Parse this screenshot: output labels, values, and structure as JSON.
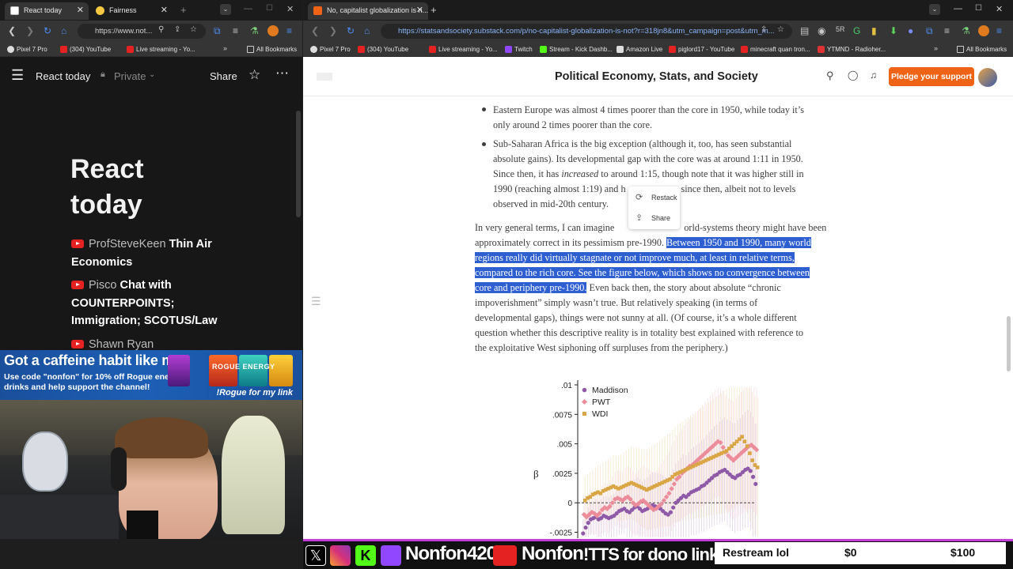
{
  "left_browser": {
    "tabs": [
      {
        "title": "React today",
        "active": true
      },
      {
        "title": "Fairness",
        "active": false
      }
    ],
    "url": "https://www.not...",
    "bookmarks": [
      "Pixel 7 Pro",
      "(304) YouTube",
      "Live streaming - Yo...",
      "All Bookmarks"
    ],
    "page_header": {
      "title": "React today",
      "private_label": "Private",
      "share_label": "Share"
    },
    "page_title": "React today",
    "items": [
      {
        "channel": "ProfSteveKeen",
        "title": "Thin Air Economics"
      },
      {
        "channel": "Pisco",
        "title": "Chat with COUNTERPOINTS; Immigration; SCOTUS/Law"
      },
      {
        "channel": "Shawn Ryan",
        "title": ""
      }
    ]
  },
  "ad_banner": {
    "headline": "Got a caffeine habit like me?",
    "body": "Use code \"nonfon\" for 10% off Rogue energy drinks and help support the channel!",
    "cta": "!Rogue for my link",
    "can_brand": "ROGUE ENERGY"
  },
  "right_browser": {
    "tab_title": "No, capitalist globalization is n...",
    "url": "https://statsandsociety.substack.com/p/no-capitalist-globalization-is-not?r=318jn8&utm_campaign=post&utm_m...",
    "bookmarks": [
      "Pixel 7 Pro",
      "(304) YouTube",
      "Live streaming - Yo...",
      "Twitch",
      "Stream - Kick Dashb...",
      "Amazon Live",
      "piglord17 - YouTube",
      "minecraft quan tron...",
      "YTMND - Radioher...",
      "All Bookmarks"
    ],
    "site_title": "Political Economy, Stats, and Society",
    "pledge_label": "Pledge your support"
  },
  "article": {
    "bullet1": [
      "Eastern Europe was almost 4 times poorer than the core in 1950, while today it’s",
      "only around 2 times poorer than the core."
    ],
    "bullet2": [
      "Sub-Saharan Africa is the big exception (although it, too, has seen substantial",
      "absolute gains). Its developmental gap with the core was at around 1:11 in 1950.",
      "Since then, it has",
      "increased",
      "to around 1:15, though note that it was higher still in",
      "1990 (reaching almost 1:19) and h",
      "since then, albeit not to levels",
      "observed in mid-20th century."
    ],
    "para": {
      "l1a": "In very general terms, I can imagine",
      "l1b": "orld-systems theory might have been",
      "l2a": "approximately correct in its pessimism pre-1990.",
      "l2b": "Between 1950 and 1990, many world",
      "l3": "regions really did virtually stagnate or not improve much, at least in relative terms,",
      "l4": "compared to the rich core. See the figure below, which shows no convergence between",
      "l5a": "core and periphery pre-1990.",
      "l5b": "Even back then, the story about absolute “chronic",
      "l6": "impoverishment” simply wasn’t true. But relatively speaking (in terms of",
      "l7": "developmental gaps), things were not sunny at all. (Of course, it’s a whole different",
      "l8": "question whether this descriptive reality is in totality best explained with reference to",
      "l9": "the exploitative West siphoning off surpluses from the periphery.)"
    }
  },
  "context_menu": {
    "restack": "Restack",
    "share": "Share"
  },
  "chart_data": {
    "type": "scatter",
    "ylabel": "β",
    "ylim": [
      -0.003,
      0.01
    ],
    "yticks": [
      ".01",
      ".0075",
      ".005",
      ".0025",
      "0",
      "-.0025"
    ],
    "x": [
      1,
      2,
      3,
      4,
      5,
      6,
      7,
      8,
      9,
      10,
      11,
      12,
      13,
      14,
      15,
      16,
      17,
      18,
      19,
      20,
      21,
      22,
      23,
      24,
      25,
      26,
      27,
      28,
      29,
      30,
      31,
      32,
      33,
      34,
      35,
      36,
      37,
      38,
      39,
      40,
      41,
      42,
      43,
      44,
      45,
      46,
      47,
      48,
      49,
      50,
      51,
      52,
      53,
      54,
      55,
      56,
      57,
      58,
      59,
      60,
      61,
      62,
      63,
      64,
      65,
      66,
      67,
      68
    ],
    "series": [
      {
        "name": "Maddison",
        "color": "#8e5aa8",
        "values": [
          -0.0026,
          -0.0021,
          -0.0017,
          -0.0014,
          -0.0013,
          -0.0012,
          -0.0014,
          -0.0013,
          -0.0011,
          -0.0012,
          -0.0013,
          -0.0012,
          -0.0011,
          -0.0009,
          -0.0007,
          -0.0006,
          -0.0005,
          -0.0007,
          -0.0008,
          -0.0006,
          -0.0004,
          -0.0003,
          -0.0005,
          -0.0007,
          -0.0006,
          -0.0005,
          -0.0003,
          -0.0002,
          -0.0003,
          -0.0004,
          -0.0005,
          -0.0007,
          -0.0009,
          -0.001,
          -0.0008,
          -0.0004,
          0.0,
          0.0002,
          0.0004,
          0.0006,
          0.0005,
          0.0007,
          0.0009,
          0.001,
          0.0011,
          0.0012,
          0.0014,
          0.0015,
          0.0017,
          0.0019,
          0.0021,
          0.0023,
          0.0024,
          0.0026,
          0.0027,
          0.0028,
          0.0026,
          0.0024,
          0.0022,
          0.0021,
          0.0023,
          0.0024,
          0.0026,
          0.0028,
          0.0029,
          0.0027,
          0.0022,
          0.0016
        ]
      },
      {
        "name": "PWT",
        "color": "#ec8c9b",
        "values": [
          -0.001,
          -0.0012,
          -0.001,
          -0.0008,
          -0.0009,
          -0.0011,
          -0.0009,
          -0.0006,
          -0.0004,
          -0.0005,
          -0.0003,
          0.0,
          0.0003,
          0.0004,
          0.0003,
          0.0002,
          0.0004,
          0.0005,
          0.0003,
          0.0,
          -0.0002,
          -0.0001,
          0.0001,
          0.0002,
          0.0,
          -0.0002,
          -0.0004,
          -0.0006,
          -0.0005,
          -0.0003,
          -0.0001,
          0.0002,
          0.0005,
          0.0008,
          0.0012,
          0.0016,
          0.002,
          0.0022,
          0.0025,
          0.0027,
          0.0029,
          0.0031,
          0.0032,
          0.0034,
          0.0036,
          0.0038,
          0.004,
          0.0042,
          0.0044,
          0.0046,
          0.0048,
          0.005,
          0.0052,
          0.0051,
          0.0047,
          0.0043,
          0.004,
          0.0038,
          0.0036,
          0.0038,
          0.004,
          0.0042,
          0.0044,
          0.0046,
          0.0048,
          0.0049,
          0.0047,
          0.0045
        ]
      },
      {
        "name": "WDI",
        "color": "#d9a545",
        "values": [
          0.0002,
          0.0004,
          0.0005,
          0.0007,
          0.0008,
          0.0009,
          0.0008,
          0.001,
          0.0011,
          0.0012,
          0.0013,
          0.0014,
          0.0013,
          0.0012,
          0.0013,
          0.0014,
          0.0015,
          0.0016,
          0.0017,
          0.0016,
          0.0015,
          0.0014,
          0.0013,
          0.0012,
          0.0011,
          0.0012,
          0.0013,
          0.0014,
          0.0015,
          0.0016,
          0.0017,
          0.0018,
          0.0019,
          0.002,
          0.0022,
          0.0024,
          0.0025,
          0.0026,
          0.0027,
          0.0028,
          0.0029,
          0.003,
          0.0031,
          0.0032,
          0.0033,
          0.0034,
          0.0035,
          0.0036,
          0.0037,
          0.0038,
          0.0039,
          0.004,
          0.0041,
          0.0042,
          0.0043,
          0.0044,
          0.0046,
          0.0048,
          0.005,
          0.0052,
          0.0054,
          0.0056,
          0.0052,
          0.0048,
          0.0042,
          0.0036,
          0.0032,
          0.003
        ]
      }
    ],
    "error_bars": true,
    "zero_line": true,
    "legend_position": "top-left"
  },
  "stream_bar": {
    "handle": "Nonfon420",
    "yt_name": "Nonfon",
    "tts": "!TTS for dono link",
    "goal_label": "Restream lol",
    "goal_current": "$0",
    "goal_target": "$100"
  },
  "colors": {
    "highlight": "#2e5fd1",
    "pledge": "#ef6317",
    "stream_border": "#c43bd8"
  }
}
